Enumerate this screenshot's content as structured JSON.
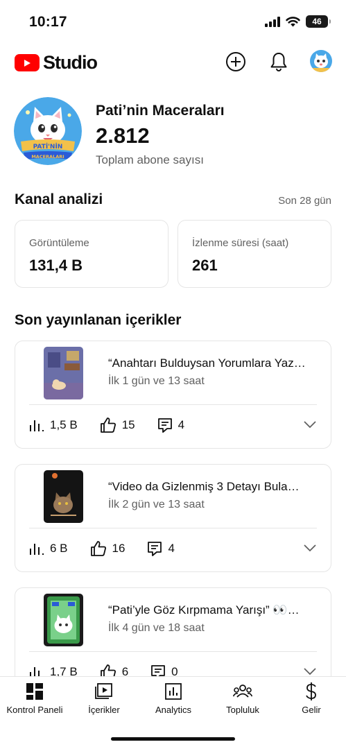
{
  "status_bar": {
    "time": "10:17",
    "battery": "46",
    "battery_level": 0.46
  },
  "header": {
    "logo_text": "Studio",
    "logo_color": "#ff0000"
  },
  "channel": {
    "name": "Pati’nin Maceraları",
    "subscribers": "2.812",
    "subscribers_label": "Toplam abone sayısı"
  },
  "analytics": {
    "title": "Kanal analizi",
    "period": "Son 28 gün",
    "cards": [
      {
        "label": "Görüntüleme",
        "value": "131,4 B"
      },
      {
        "label": "İzlenme süresi (saat)",
        "value": "261"
      }
    ]
  },
  "recent": {
    "title": "Son yayınlanan içerikler",
    "videos": [
      {
        "title": "“Anahtarı Bulduysan Yorumlara Yaz…",
        "meta": "İlk 1 gün ve 13 saat",
        "views": "1,5 B",
        "likes": "15",
        "comments": "4"
      },
      {
        "title": "“Video da Gizlenmiş 3 Detayı Bula…",
        "meta": "İlk 2 gün ve 13 saat",
        "views": "6 B",
        "likes": "16",
        "comments": "4"
      },
      {
        "title": "“Pati’yle Göz Kırpmama Yarışı” 👀…",
        "meta": "İlk 4 gün ve 18 saat",
        "views": "1,7 B",
        "likes": "6",
        "comments": "0"
      }
    ]
  },
  "bottom_nav": [
    {
      "label": "Kontrol Paneli",
      "icon": "dashboard-icon"
    },
    {
      "label": "İçerikler",
      "icon": "content-icon"
    },
    {
      "label": "Analytics",
      "icon": "analytics-icon"
    },
    {
      "label": "Topluluk",
      "icon": "community-icon"
    },
    {
      "label": "Gelir",
      "icon": "earn-icon"
    }
  ]
}
